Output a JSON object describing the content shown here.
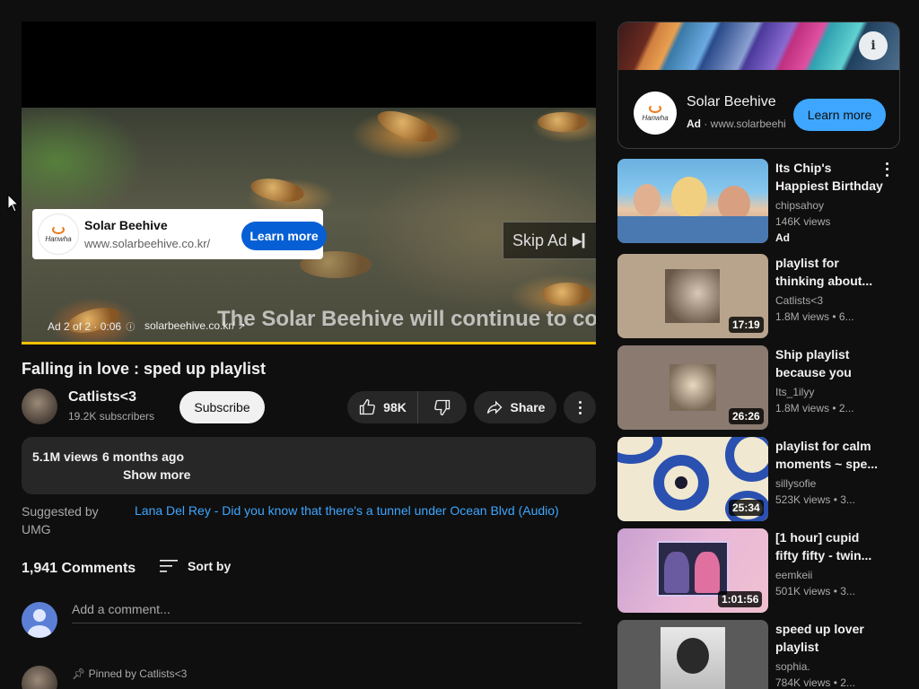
{
  "player": {
    "ad_overlay": {
      "logo_text": "Hanwha",
      "title": "Solar Beehive",
      "url": "www.solarbeehive.co.kr/",
      "cta": "Learn more"
    },
    "skip_ad": "Skip Ad",
    "caption": "The Solar Beehive will continue to colle",
    "ad_info": "Ad 2 of 2 · 0:06",
    "ad_site": "solarbeehive.co.kr/",
    "progress_color": "#f2c200"
  },
  "video": {
    "title": "Falling in love : sped up playlist",
    "channel": "Catlists<3",
    "subscribers": "19.2K subscribers",
    "subscribe_label": "Subscribe",
    "likes": "98K",
    "share_label": "Share"
  },
  "description": {
    "views": "5.1M views",
    "date": "6 months ago",
    "show_more": "Show more"
  },
  "suggested": {
    "label": "Suggested by UMG",
    "link": "Lana Del Rey - Did you know that there's a tunnel under Ocean Blvd (Audio)"
  },
  "comments": {
    "count": "1,941 Comments",
    "sort_label": "Sort by",
    "placeholder": "Add a comment...",
    "pinned": "Pinned by Catlists<3"
  },
  "side_ad": {
    "logo_text": "Hanwha",
    "title": "Solar Beehive",
    "ad_label": "Ad",
    "url": "www.solarbeehive.co.kr",
    "cta": "Learn more"
  },
  "recommendations": [
    {
      "title": "Its Chip's Happiest Birthday",
      "channel": "chipsahoy",
      "meta": "146K views",
      "badge": "Ad",
      "duration": ""
    },
    {
      "title": "playlist for thinking about...",
      "channel": "Catlists<3",
      "meta": "1.8M views  • 6...",
      "duration": "17:19"
    },
    {
      "title": "Ship playlist because you are...",
      "channel": "Its_1ilyy",
      "meta": "1.8M views  • 2...",
      "duration": "26:26"
    },
    {
      "title": "playlist for calm moments ~ spe...",
      "channel": "sillysofie",
      "meta": "523K views  • 3...",
      "duration": "25:34"
    },
    {
      "title": "[1 hour] cupid fifty fifty - twin...",
      "channel": "eemkeii",
      "meta": "501K views  • 3...",
      "duration": "1:01:56"
    },
    {
      "title": "speed up lover playlist",
      "channel": "sophia.",
      "meta": "784K views  • 2...",
      "duration": ""
    }
  ],
  "colors": {
    "background": "#0f0f0f",
    "surface": "#272727",
    "accent_blue": "#3ea6ff",
    "ad_blue": "#065fd4"
  }
}
